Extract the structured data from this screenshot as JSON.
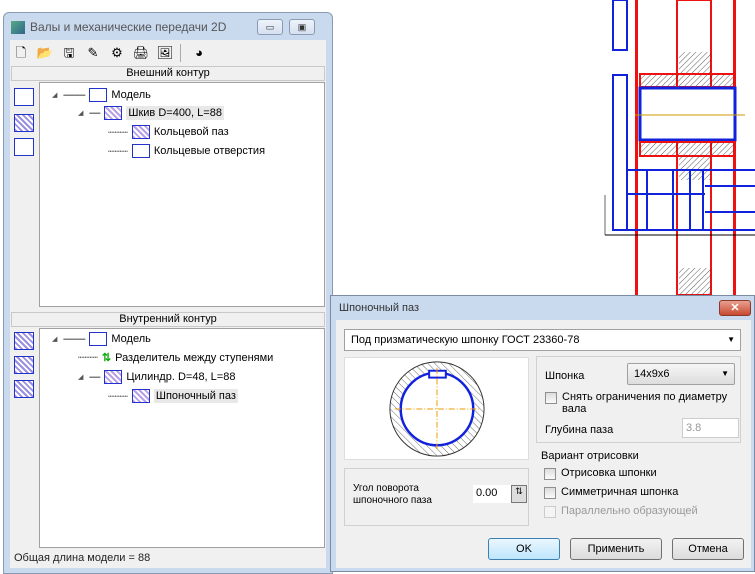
{
  "main_window": {
    "title": "Валы и механические передачи 2D",
    "toolbar": [
      "new-icon",
      "open-icon",
      "save-icon",
      "edit-icon",
      "gear-icon",
      "print-icon",
      "image-icon",
      "app-icon"
    ],
    "outer": {
      "header": "Внешний контур",
      "tree": [
        {
          "label": "Модель"
        },
        {
          "label": "Шкив D=400, L=88"
        },
        {
          "label": "Кольцевой паз"
        },
        {
          "label": "Кольцевые отверстия"
        }
      ]
    },
    "inner": {
      "header": "Внутренний контур",
      "tree": [
        {
          "label": "Модель"
        },
        {
          "label": "Разделитель между ступенями"
        },
        {
          "label": "Цилиндр. D=48, L=88"
        },
        {
          "label": "Шпоночный паз"
        }
      ]
    },
    "status": "Общая длина модели = 88"
  },
  "dialog": {
    "title": "Шпоночный паз",
    "type_select": "Под призматическую шпонку ГОСТ 23360-78",
    "key_label": "Шпонка",
    "key_value": "14x9x6",
    "remove_limits": "Снять ограничения по диаметру вала",
    "depth_label": "Глубина паза",
    "depth_value": "3.8",
    "angle_label": "Угол поворота шпоночного паза",
    "angle_value": "0.00",
    "variant_label": "Вариант отрисовки",
    "draw_key": "Отрисовка шпонки",
    "symmetric_key": "Симметричная шпонка",
    "parallel": "Параллельно образующей",
    "ok": "OK",
    "apply": "Применить",
    "cancel": "Отмена"
  },
  "colors": {
    "drawing_red": "#ee1111",
    "drawing_blue": "#1122dd",
    "frame": "#c9d9ee"
  }
}
